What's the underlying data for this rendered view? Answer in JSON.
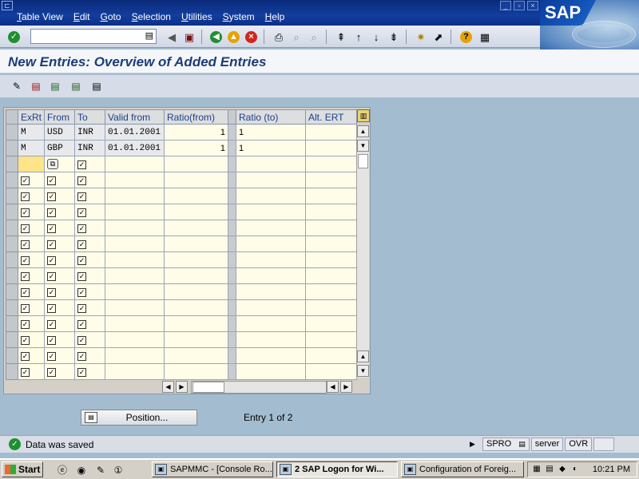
{
  "menubar": {
    "items": [
      {
        "label": "Table View",
        "u": "T"
      },
      {
        "label": "Edit",
        "u": "E"
      },
      {
        "label": "Goto",
        "u": "G"
      },
      {
        "label": "Selection",
        "u": "S"
      },
      {
        "label": "Utilities",
        "u": "U"
      },
      {
        "label": "System",
        "u": "S"
      },
      {
        "label": "Help",
        "u": "H"
      }
    ],
    "logo": "SAP"
  },
  "page": {
    "title": "New Entries: Overview of Added Entries"
  },
  "table": {
    "columns": [
      "ExRt",
      "From",
      "To",
      "Valid from",
      "Ratio(from)",
      "",
      "Ratio (to)",
      "Alt. ERT"
    ],
    "rows": [
      {
        "exrt": "M",
        "from": "USD",
        "to": "INR",
        "valid_from": "01.01.2001",
        "ratio_from": "1",
        "ratio_to": "1",
        "alt_ert": ""
      },
      {
        "exrt": "M",
        "from": "GBP",
        "to": "INR",
        "valid_from": "01.01.2001",
        "ratio_from": "1",
        "ratio_to": "1",
        "alt_ert": ""
      }
    ],
    "empty_rows": 14
  },
  "position": {
    "button_label": "Position...",
    "entry_info": "Entry 1 of 2"
  },
  "status": {
    "message": "Data was saved",
    "transaction": "SPRO",
    "server": "server",
    "mode": "OVR"
  },
  "taskbar": {
    "start_label": "Start",
    "tasks": [
      {
        "label": "SAPMMC - [Console Ro...",
        "active": false
      },
      {
        "label": "2 SAP Logon for Wi...",
        "active": true
      },
      {
        "label": "Configuration of Foreig...",
        "active": false
      }
    ],
    "clock": "10:21 PM"
  },
  "colors": {
    "menubar": "#0a2a7a",
    "title_text": "#1d3c78",
    "status_ok": "#1f8f2f",
    "background": "#a4bccf"
  }
}
